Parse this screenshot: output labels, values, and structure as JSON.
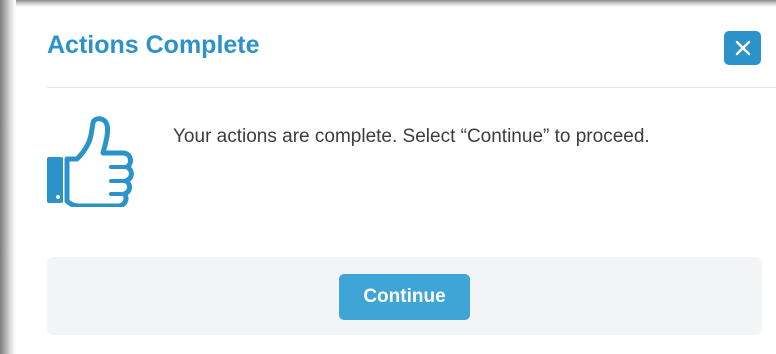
{
  "dialog": {
    "title": "Actions Complete",
    "close_icon": "close-icon",
    "message": "Your actions are complete. Select “Continue” to proceed.",
    "illustration_icon": "thumbs-up-icon",
    "continue_label": "Continue"
  },
  "colors": {
    "accent": "#2b93c9",
    "button": "#3fa5d6",
    "footer_bg": "#f3f4f6",
    "text": "#3d3d3d"
  }
}
